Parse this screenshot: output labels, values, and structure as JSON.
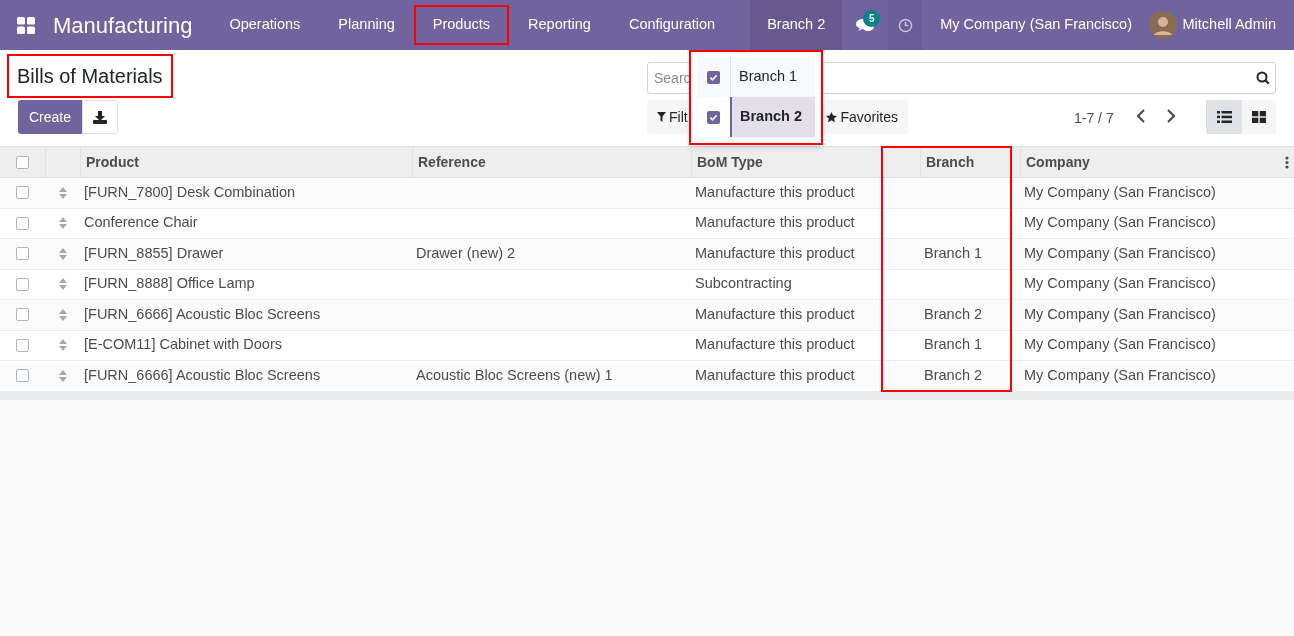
{
  "navbar": {
    "app_title": "Manufacturing",
    "menu": [
      {
        "label": "Operations",
        "highlighted": false
      },
      {
        "label": "Planning",
        "highlighted": false
      },
      {
        "label": "Products",
        "highlighted": true
      },
      {
        "label": "Reporting",
        "highlighted": false
      },
      {
        "label": "Configuration",
        "highlighted": false
      }
    ],
    "branch_switcher": {
      "label": "Branch 2",
      "expanded": true,
      "highlighted": true,
      "options": [
        {
          "label": "Branch 1",
          "checked": true,
          "selected": false
        },
        {
          "label": "Branch 2",
          "checked": true,
          "selected": true
        }
      ]
    },
    "messages_badge": "5",
    "company": "My Company (San Francisco)",
    "user": "Mitchell Admin"
  },
  "page": {
    "title": "Bills of Materials",
    "title_highlighted": true,
    "create_button": "Create",
    "search": {
      "placeholder": "Searc"
    },
    "filters_button": "Filt",
    "favorites_button": "Favorites",
    "pager": "1-7 / 7",
    "list_view_selected": true
  },
  "table": {
    "select_all_checked": false,
    "columns": [
      {
        "label": "Product",
        "highlighted": false
      },
      {
        "label": "Reference",
        "highlighted": false
      },
      {
        "label": "BoM Type",
        "highlighted": false
      },
      {
        "label": "Branch",
        "highlighted": true
      },
      {
        "label": "Company",
        "highlighted": false
      }
    ],
    "rows": [
      {
        "checked": false,
        "cells": [
          "[FURN_7800] Desk Combination",
          "",
          "Manufacture this product",
          "",
          "My Company (San Francisco)"
        ]
      },
      {
        "checked": false,
        "cells": [
          "Conference Chair",
          "",
          "Manufacture this product",
          "",
          "My Company (San Francisco)"
        ]
      },
      {
        "checked": false,
        "cells": [
          "[FURN_8855] Drawer",
          "Drawer (new) 2",
          "Manufacture this product",
          "Branch 1",
          "My Company (San Francisco)"
        ]
      },
      {
        "checked": false,
        "cells": [
          "[FURN_8888] Office Lamp",
          "",
          "Subcontracting",
          "",
          "My Company (San Francisco)"
        ]
      },
      {
        "checked": false,
        "cells": [
          "[FURN_6666] Acoustic Bloc Screens",
          "",
          "Manufacture this product",
          "Branch 2",
          "My Company (San Francisco)"
        ]
      },
      {
        "checked": false,
        "cells": [
          "[E-COM11] Cabinet with Doors",
          "",
          "Manufacture this product",
          "Branch 1",
          "My Company (San Francisco)"
        ]
      },
      {
        "checked": false,
        "cells": [
          "[FURN_6666] Acoustic Bloc Screens",
          "Acoustic Bloc Screens (new) 1",
          "Manufacture this product",
          "Branch 2",
          "My Company (San Francisco)"
        ]
      }
    ]
  }
}
